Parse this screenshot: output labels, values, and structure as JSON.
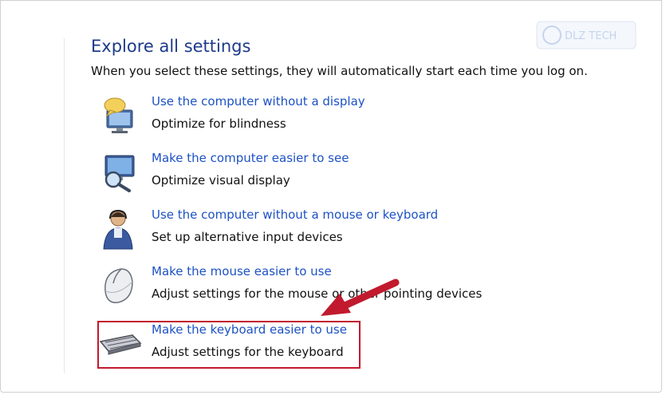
{
  "section": {
    "title": "Explore all settings",
    "description": "When you select these settings, they will automatically start each time you log on."
  },
  "items": [
    {
      "link": "Use the computer without a display",
      "description": "Optimize for blindness",
      "icon": "speech-bubble-monitor-icon"
    },
    {
      "link": "Make the computer easier to see",
      "description": "Optimize visual display",
      "icon": "magnifier-monitor-icon"
    },
    {
      "link": "Use the computer without a mouse or keyboard",
      "description": "Set up alternative input devices",
      "icon": "user-headset-icon"
    },
    {
      "link": "Make the mouse easier to use",
      "description": "Adjust settings for the mouse or other pointing devices",
      "icon": "mouse-icon"
    },
    {
      "link": "Make the keyboard easier to use",
      "description": "Adjust settings for the keyboard",
      "icon": "keyboard-icon"
    }
  ],
  "annotation": {
    "highlighted_item": "Make the keyboard easier to use",
    "color": "#c11a2e"
  },
  "watermark": {
    "text": "DLZ TECH"
  },
  "colors": {
    "title": "#1e3a8a",
    "link": "#1d52c4",
    "text": "#111111",
    "accent": "#c11a2e"
  }
}
